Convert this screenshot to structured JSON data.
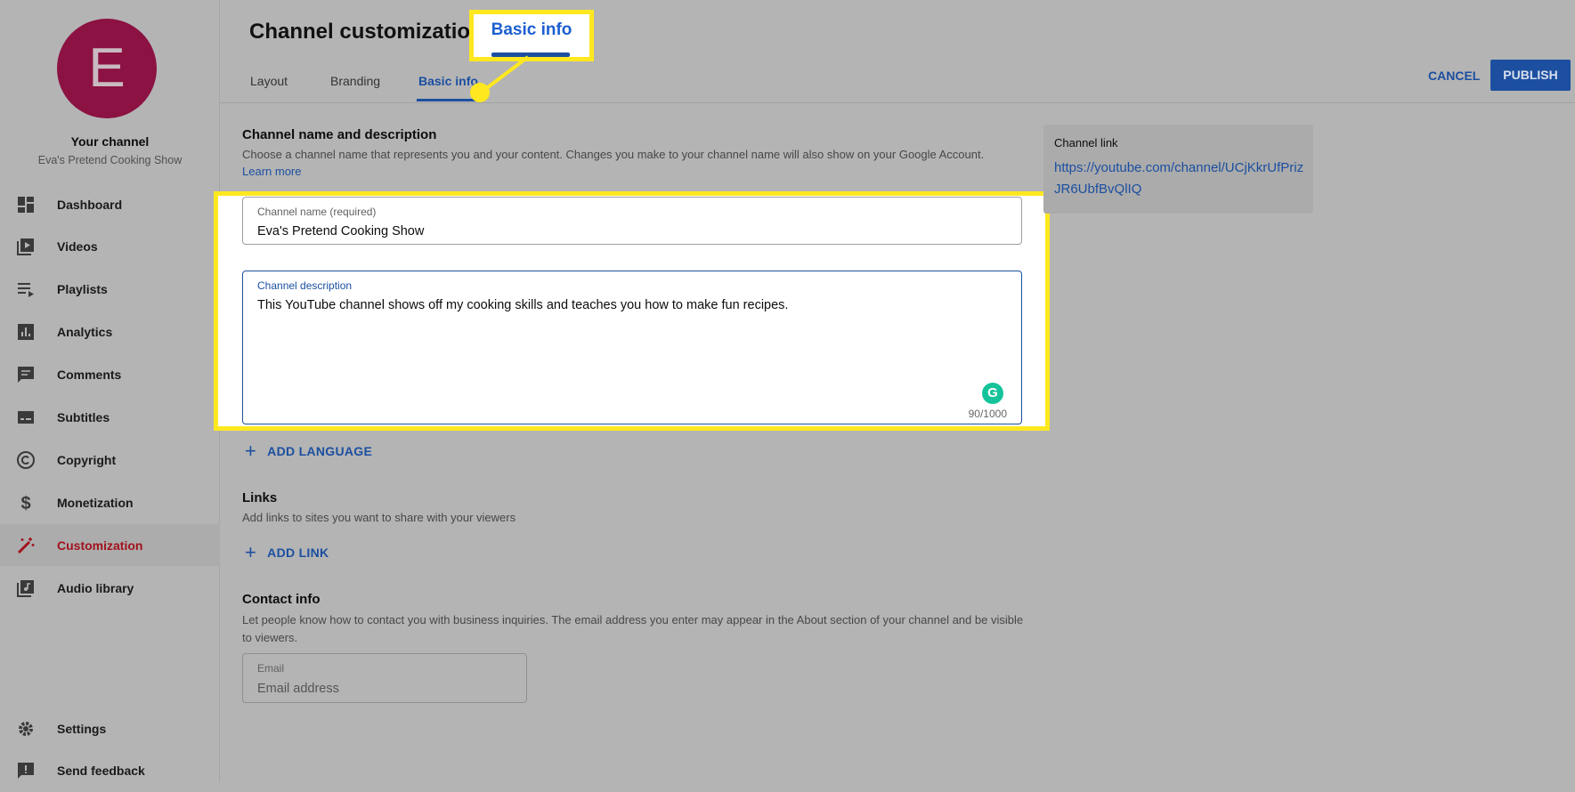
{
  "sidebar": {
    "avatar_letter": "E",
    "channel_label": "Your channel",
    "channel_name": "Eva's Pretend Cooking Show",
    "items": [
      {
        "label": "Dashboard",
        "icon": "dashboard-icon"
      },
      {
        "label": "Videos",
        "icon": "videos-icon"
      },
      {
        "label": "Playlists",
        "icon": "playlists-icon"
      },
      {
        "label": "Analytics",
        "icon": "analytics-icon"
      },
      {
        "label": "Comments",
        "icon": "comments-icon"
      },
      {
        "label": "Subtitles",
        "icon": "subtitles-icon"
      },
      {
        "label": "Copyright",
        "icon": "copyright-icon"
      },
      {
        "label": "Monetization",
        "icon": "dollar-icon"
      },
      {
        "label": "Customization",
        "icon": "magic-wand-icon",
        "active": true
      },
      {
        "label": "Audio library",
        "icon": "audio-library-icon"
      }
    ],
    "bottom": [
      {
        "label": "Settings",
        "icon": "gear-icon"
      },
      {
        "label": "Send feedback",
        "icon": "feedback-icon"
      }
    ]
  },
  "header": {
    "title": "Channel customization",
    "tabs": [
      {
        "label": "Layout"
      },
      {
        "label": "Branding"
      },
      {
        "label": "Basic info",
        "active": true
      }
    ],
    "cancel": "CANCEL",
    "publish": "PUBLISH",
    "callout": "Basic info"
  },
  "name_section": {
    "heading": "Channel name and description",
    "description": "Choose a channel name that represents you and your content. Changes you make to your channel name will also show on your Google Account.",
    "learn_more": "Learn more",
    "name_label": "Channel name (required)",
    "name_value": "Eva's Pretend Cooking Show",
    "desc_label": "Channel description",
    "desc_value": "This YouTube channel shows off my cooking skills and teaches you how to make fun recipes.",
    "counter": "90/1000",
    "add_language": "ADD LANGUAGE"
  },
  "links_section": {
    "heading": "Links",
    "description": "Add links to sites you want to share with your viewers",
    "add_link": "ADD LINK"
  },
  "contact_section": {
    "heading": "Contact info",
    "description": "Let people know how to contact you with business inquiries. The email address you enter may appear in the About section of your channel and be visible to viewers.",
    "email_label": "Email",
    "email_placeholder": "Email address"
  },
  "channel_link": {
    "label": "Channel link",
    "url": "https://youtube.com/channel/UCjKkrUfPrizJR6UbfBvQlIQ"
  },
  "colors": {
    "accent": "#1c4fa0",
    "highlight": "#ffe81f",
    "active_nav": "#a1121e",
    "avatar": "#8c1243"
  }
}
